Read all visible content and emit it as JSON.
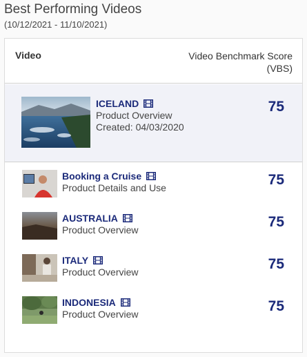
{
  "page": {
    "title": "Best Performing Videos",
    "date_range": "(10/12/2021 - 11/10/2021)"
  },
  "table": {
    "col_video": "Video",
    "col_score": "Video Benchmark Score (VBS)",
    "rows": [
      {
        "title": "ICELAND",
        "subtitle": "Product Overview",
        "created": "Created: 04/03/2020",
        "score": "75",
        "icon": "film-icon"
      },
      {
        "title": "Booking a Cruise",
        "subtitle": "Product Details and Use",
        "score": "75",
        "icon": "film-icon"
      },
      {
        "title": "AUSTRALIA",
        "subtitle": "Product Overview",
        "score": "75",
        "icon": "film-icon"
      },
      {
        "title": "ITALY",
        "subtitle": "Product Overview",
        "score": "75",
        "icon": "film-icon"
      },
      {
        "title": "INDONESIA",
        "subtitle": "Product Overview",
        "score": "75",
        "icon": "film-icon"
      }
    ]
  },
  "colors": {
    "accent": "#1b2a7a",
    "featured_bg": "#f1f2f8"
  }
}
